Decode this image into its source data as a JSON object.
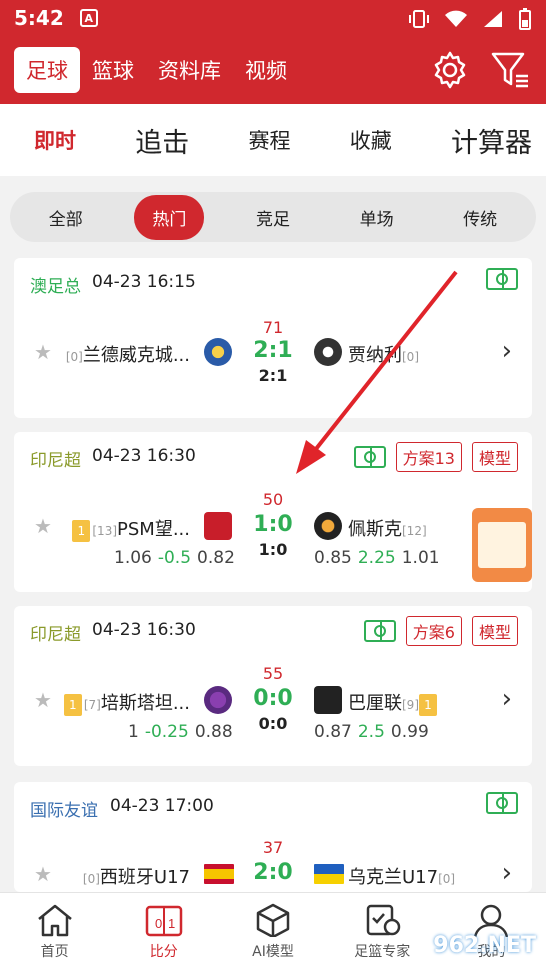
{
  "status": {
    "time": "5:42",
    "app_badge": "A"
  },
  "header": {
    "tabs": [
      "足球",
      "篮球",
      "资料库",
      "视频"
    ],
    "icons": [
      "gear-icon",
      "filter-icon"
    ]
  },
  "subnav": [
    "即时",
    "追击",
    "赛程",
    "收藏",
    "计算器"
  ],
  "pills": [
    "全部",
    "热门",
    "竞足",
    "单场",
    "传统"
  ],
  "matches": [
    {
      "league": "澳足总",
      "league_color": "#2fae55",
      "time": "04-23 16:15",
      "home_rank": "[0]",
      "home": "兰德威克城...",
      "away": "贾纳利",
      "away_rank": "[0]",
      "minute": "71",
      "score": "2:1",
      "ht": "2:1"
    },
    {
      "league": "印尼超",
      "league_color": "#8a9a2a",
      "time": "04-23 16:30",
      "tag1": "方案13",
      "tag2": "模型",
      "home_badge": "1",
      "home_rank": "[13]",
      "home": "PSM望...",
      "away": "佩斯克",
      "away_rank": "[12]",
      "minute": "50",
      "score": "1:0",
      "ht": "1:0",
      "odds_home": [
        "1.06",
        "-0.5",
        "0.82"
      ],
      "odds_away": [
        "0.85",
        "2.25",
        "1.01"
      ]
    },
    {
      "league": "印尼超",
      "league_color": "#8a9a2a",
      "time": "04-23 16:30",
      "tag1": "方案6",
      "tag2": "模型",
      "home_badge": "1",
      "home_rank": "[7]",
      "home": "培斯塔坦...",
      "away": "巴厘联",
      "away_rank": "[9]",
      "away_badge": "1",
      "minute": "55",
      "score": "0:0",
      "ht": "0:0",
      "odds_home": [
        "1",
        "-0.25",
        "0.88"
      ],
      "odds_away": [
        "0.87",
        "2.5",
        "0.99"
      ]
    },
    {
      "league": "国际友谊",
      "league_color": "#3a6fb0",
      "time": "04-23 17:00",
      "home_rank": "[0]",
      "home": "西班牙U17",
      "away": "乌克兰U17",
      "away_rank": "[0]",
      "minute": "37",
      "score": "2:0"
    }
  ],
  "bottom_nav": [
    {
      "label": "首页",
      "icon": "home-icon"
    },
    {
      "label": "比分",
      "icon": "scoreboard-icon"
    },
    {
      "label": "AI模型",
      "icon": "cube-icon"
    },
    {
      "label": "足篮专家",
      "icon": "expert-icon"
    },
    {
      "label": "我的",
      "icon": "user-icon"
    }
  ],
  "watermark": "962.NET"
}
